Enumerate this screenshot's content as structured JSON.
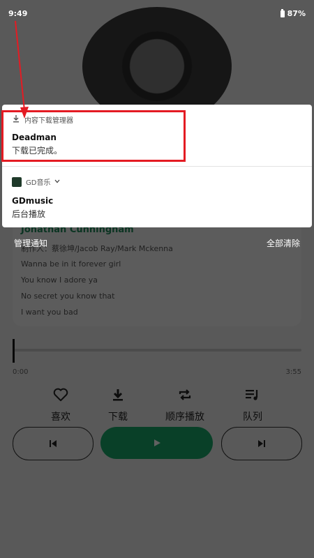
{
  "status_bar": {
    "time": "9:49",
    "battery": "87%"
  },
  "notifications": [
    {
      "app_name": "内容下载管理器",
      "title": "Deadman",
      "body": "下载已完成。"
    },
    {
      "app_name": "GD音乐",
      "title": "GDmusic",
      "body": "后台播放"
    }
  ],
  "shade_footer": {
    "manage": "管理通知",
    "clear_all": "全部清除"
  },
  "player": {
    "artist": "Jonathan Cunningham",
    "lyrics": [
      "制作人：蔡徐坤/Jacob Ray/Mark Mckenna",
      "Wanna be in it forever girl",
      "You know I adore ya",
      "No secret you know that",
      "I want you bad"
    ],
    "time_current": "0:00",
    "time_total": "3:55",
    "progress_fraction": 0.0,
    "controls": [
      {
        "icon": "heart-icon",
        "label": "喜欢"
      },
      {
        "icon": "download-icon",
        "label": "下载"
      },
      {
        "icon": "repeat-icon",
        "label": "顺序播放"
      },
      {
        "icon": "queue-icon",
        "label": "队列"
      }
    ]
  },
  "colors": {
    "accent": "#1aa86a",
    "annotation": "#e41b23"
  }
}
